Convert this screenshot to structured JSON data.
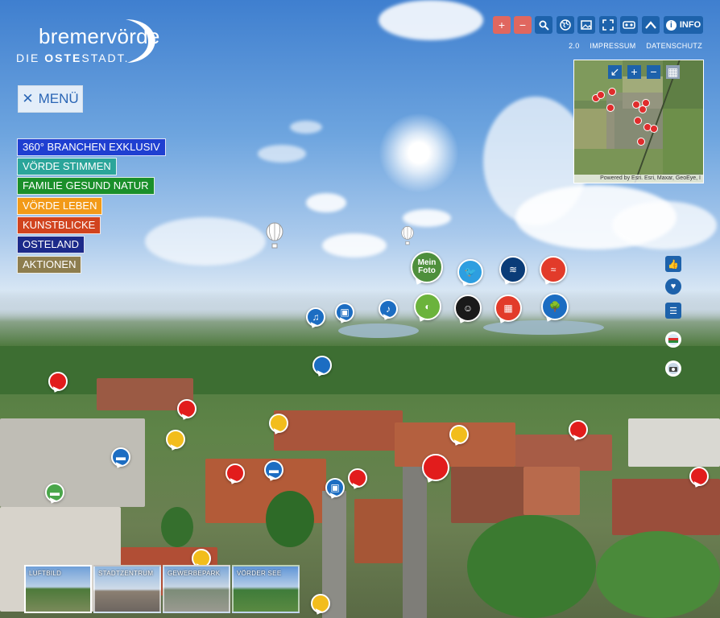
{
  "logo": {
    "name": "bremervörde",
    "tagline_pre": "DIE ",
    "tagline_bold": "OSTE",
    "tagline_post": "STADT."
  },
  "menu": {
    "icon": "close-icon",
    "label": "MENÜ"
  },
  "categories": [
    {
      "label": "360° BRANCHEN EXKLUSIV",
      "color": "#1f3fd1"
    },
    {
      "label": "VÖRDE STIMMEN",
      "color": "#2ba59a"
    },
    {
      "label": "FAMILIE GESUND NATUR",
      "color": "#1a8f2a"
    },
    {
      "label": "VÖRDE LEBEN",
      "color": "#f29a18"
    },
    {
      "label": "KUNSTBLICKE",
      "color": "#d1431e"
    },
    {
      "label": "OSTELAND",
      "color": "#1c2a8a"
    },
    {
      "label": "AKTIONEN",
      "color": "#8d7d4e"
    }
  ],
  "toolbar": {
    "buttons": [
      "zoom-in-icon",
      "zoom-out-icon",
      "search-icon",
      "globe-icon",
      "image-icon",
      "fullscreen-icon",
      "vr-glasses-icon",
      "chevron-up-icon"
    ],
    "info_label": "INFO"
  },
  "links": {
    "l1": "2.0",
    "l2": "IMPRESSUM",
    "l3": "DATENSCHUTZ"
  },
  "map": {
    "attribution": "Powered by Esri. Esri, Maxar, GeoEye, I"
  },
  "hotspot_labels": {
    "mein_foto": "Mein Foto"
  },
  "thumbs": [
    {
      "label": "LUFTBILD"
    },
    {
      "label": "STADTZENTRUM"
    },
    {
      "label": "GEWERBEPARK"
    },
    {
      "label": "VÖRDER SEE"
    }
  ],
  "colors": {
    "toolbar_blue": "#1d62ab",
    "toolbar_red": "#e0675f",
    "hotspot_red": "#e21c1c",
    "hotspot_yellow": "#f2bd1c",
    "hotspot_blue": "#1c6dc2"
  }
}
